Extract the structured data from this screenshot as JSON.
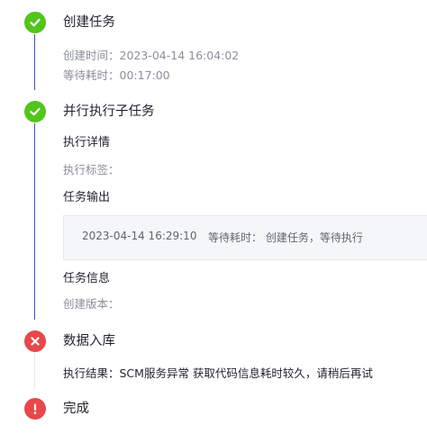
{
  "steps": [
    {
      "title": "创建任务",
      "status": "success",
      "created_time": "创建时间：2023-04-14 16:04:02",
      "wait_time": "等待耗时：00:17:00"
    },
    {
      "title": "并行执行子任务",
      "status": "success",
      "exec_detail_heading": "执行详情",
      "exec_tag_label": "执行标签：",
      "output_heading": "任务输出",
      "output": {
        "time": "2023-04-14 16:29:10",
        "text": "等待耗时：  创建任务，等待执行"
      },
      "task_info_heading": "任务信息",
      "created_version_label": "创建版本："
    },
    {
      "title": "数据入库",
      "status": "failed",
      "result": "执行结果：SCM服务异常 获取代码信息耗时较久，请稍后再试"
    },
    {
      "title": "完成",
      "status": "error"
    }
  ],
  "colors": {
    "success": "#52c41a",
    "failed": "#e8474b",
    "line_done": "#3f51b5",
    "line_pending": "#e5e6eb"
  }
}
